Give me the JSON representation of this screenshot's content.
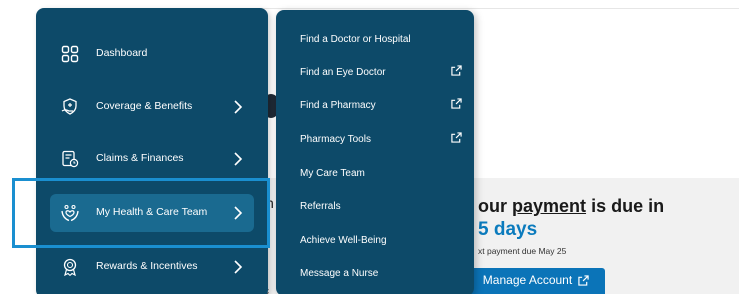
{
  "nav": {
    "items": [
      {
        "label": "Dashboard",
        "icon": "dashboard-grid-icon",
        "chevron": false,
        "active": false
      },
      {
        "label": "Coverage & Benefits",
        "icon": "shield-hand-icon",
        "chevron": true,
        "active": false
      },
      {
        "label": "Claims & Finances",
        "icon": "receipt-clock-icon",
        "chevron": true,
        "active": false
      },
      {
        "label": "My Health & Care Team",
        "icon": "hands-heart-icon",
        "chevron": true,
        "active": true
      },
      {
        "label": "Rewards & Incentives",
        "icon": "award-ribbon-icon",
        "chevron": true,
        "active": false
      }
    ]
  },
  "submenu": {
    "items": [
      {
        "label": "Find a Doctor or Hospital",
        "external": false
      },
      {
        "label": "Find an Eye Doctor",
        "external": true
      },
      {
        "label": "Find a Pharmacy",
        "external": true
      },
      {
        "label": "Pharmacy Tools",
        "external": true
      },
      {
        "label": "My Care Team",
        "external": false
      },
      {
        "label": "Referrals",
        "external": false
      },
      {
        "label": "Achieve Well-Being",
        "external": false
      },
      {
        "label": "Message a Nurse",
        "external": false
      }
    ]
  },
  "payment": {
    "title_prefix": "our",
    "title_link": "payment",
    "title_suffix": "is due in",
    "days": "5 days",
    "next_payment": "xt payment due May 25",
    "manage_button": "Manage Account"
  },
  "background": {
    "fragment_h": "h",
    "fragment_bottom": "c"
  },
  "colors": {
    "menu_bg": "#0d4a69",
    "menu_active": "#1a6a90",
    "highlight_border": "#1a8fd0",
    "accent_blue": "#0b74b8",
    "days_blue": "#0b7bbd"
  }
}
